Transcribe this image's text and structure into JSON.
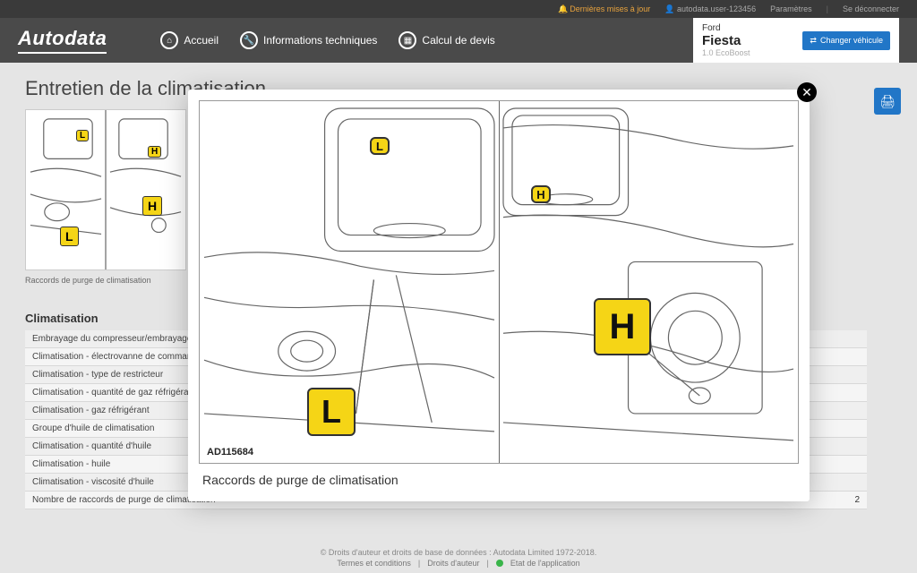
{
  "topbar_upper": {
    "updates": "Dernières mises à jour",
    "user": "autodata.user-123456",
    "settings": "Paramètres",
    "logout": "Se déconnecter"
  },
  "logo": "Autodata",
  "nav": {
    "home": "Accueil",
    "tech": "Informations techniques",
    "estimate": "Calcul de devis"
  },
  "vehicle": {
    "make": "Ford",
    "model": "Fiesta",
    "variant": "1.0 EcoBoost",
    "change": "Changer véhicule"
  },
  "page_title": "Entretien de la climatisation",
  "thumb_caption": "Raccords de purge de climatisation",
  "section_title": "Climatisation",
  "specs": [
    {
      "label": "Embrayage du compresseur/embrayage magnétique",
      "value": ""
    },
    {
      "label": "Climatisation - électrovanne de commande de capacité",
      "value": ""
    },
    {
      "label": "Climatisation - type de restricteur",
      "value": ""
    },
    {
      "label": "Climatisation - quantité de gaz réfrigérant",
      "value": ""
    },
    {
      "label": "Climatisation - gaz réfrigérant",
      "value": ""
    },
    {
      "label": "Groupe d'huile de climatisation",
      "value": ""
    },
    {
      "label": "Climatisation - quantité d'huile",
      "value": ""
    },
    {
      "label": "Climatisation - huile",
      "value": ""
    },
    {
      "label": "Climatisation - viscosité d'huile",
      "value": ""
    },
    {
      "label": "Nombre de raccords de purge de climatisation",
      "value": "2"
    }
  ],
  "modal": {
    "ref": "AD115684",
    "caption": "Raccords de purge de climatisation",
    "label_low": "L",
    "label_high": "H"
  },
  "footer": {
    "copyright": "© Droits d'auteur et droits de base de données : Autodata Limited 1972-2018.",
    "terms": "Termes et conditions",
    "rights": "Droits d'auteur",
    "status": "Etat de l'application"
  }
}
